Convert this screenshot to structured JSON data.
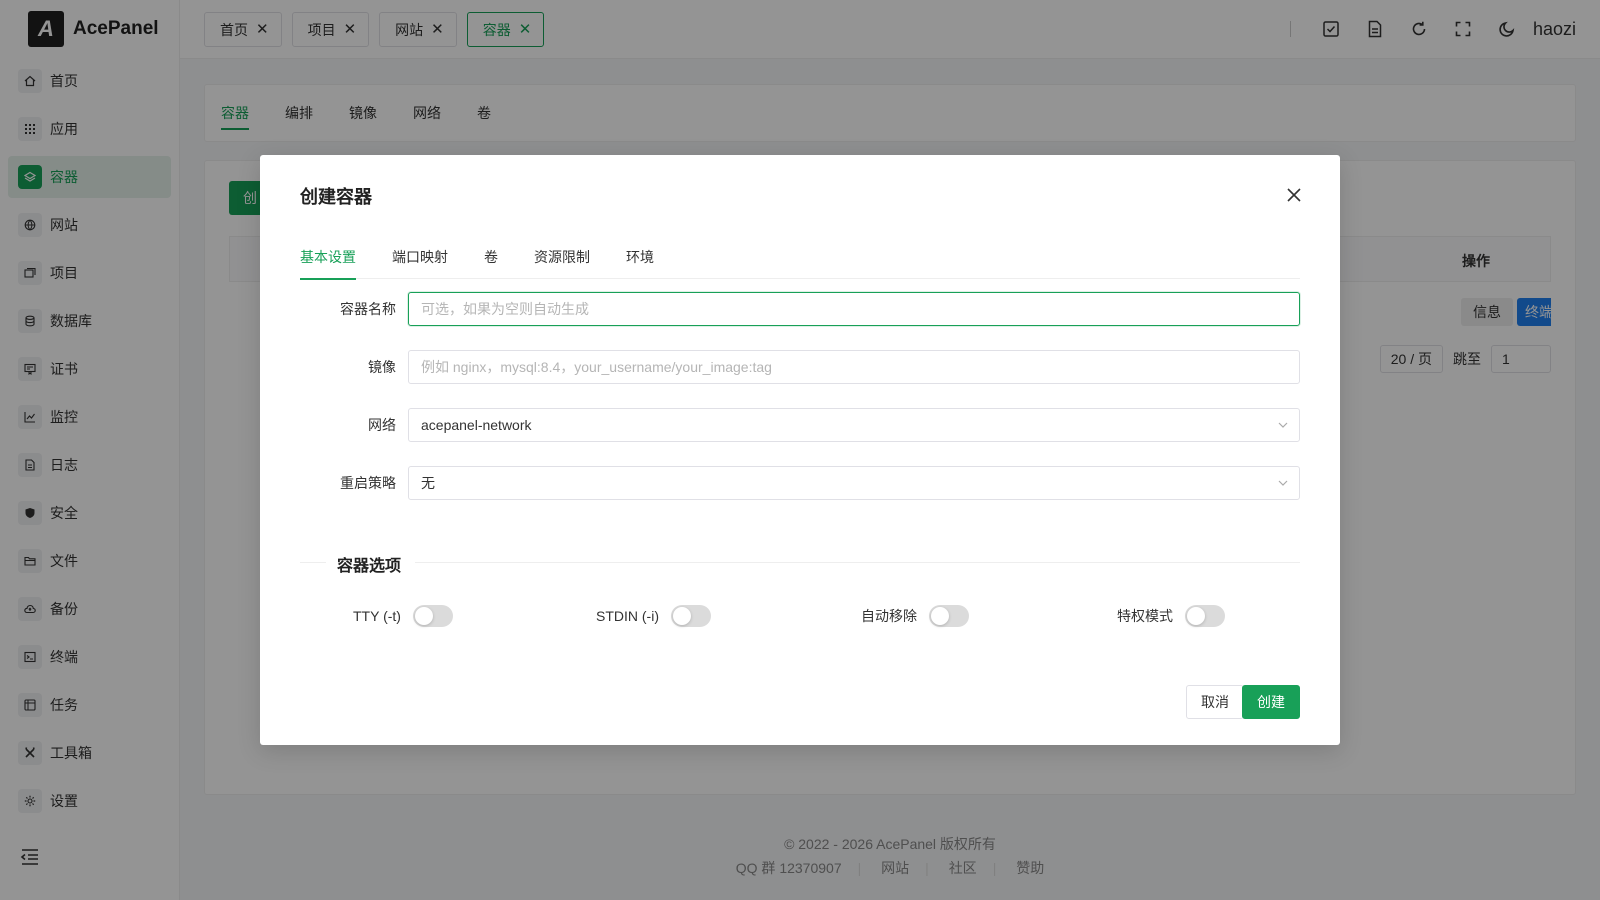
{
  "brand": {
    "logo": "A",
    "name": "AcePanel"
  },
  "sidebar": {
    "items": [
      {
        "label": "首页",
        "icon": "home-icon"
      },
      {
        "label": "应用",
        "icon": "grid-icon"
      },
      {
        "label": "容器",
        "icon": "layers-icon",
        "active": true
      },
      {
        "label": "网站",
        "icon": "globe-icon"
      },
      {
        "label": "项目",
        "icon": "folder-stack-icon"
      },
      {
        "label": "数据库",
        "icon": "database-icon"
      },
      {
        "label": "证书",
        "icon": "certificate-icon"
      },
      {
        "label": "监控",
        "icon": "chart-line-icon"
      },
      {
        "label": "日志",
        "icon": "document-icon"
      },
      {
        "label": "安全",
        "icon": "shield-icon"
      },
      {
        "label": "文件",
        "icon": "folder-icon"
      },
      {
        "label": "备份",
        "icon": "cloud-backup-icon"
      },
      {
        "label": "终端",
        "icon": "terminal-icon"
      },
      {
        "label": "任务",
        "icon": "task-icon"
      },
      {
        "label": "工具箱",
        "icon": "tools-icon"
      },
      {
        "label": "设置",
        "icon": "gear-icon"
      }
    ]
  },
  "header": {
    "tabs": [
      {
        "label": "首页"
      },
      {
        "label": "项目"
      },
      {
        "label": "网站"
      },
      {
        "label": "容器",
        "active": true
      }
    ],
    "username": "haozi"
  },
  "main": {
    "subtabs": [
      "容器",
      "编排",
      "镜像",
      "网络",
      "卷"
    ],
    "create_label": "创",
    "table": {
      "op_header": "操作",
      "info_btn": "信息",
      "term_btn": "终端"
    },
    "pager": {
      "page_size": "20 / 页",
      "jump_label": "跳至",
      "jump_value": "1"
    }
  },
  "footer": {
    "copyright": "© 2022 - 2026 AcePanel 版权所有",
    "qq": "QQ 群 12370907",
    "link_site": "网站",
    "link_community": "社区",
    "link_sponsor": "赞助"
  },
  "modal": {
    "title": "创建容器",
    "tabs": [
      "基本设置",
      "端口映射",
      "卷",
      "资源限制",
      "环境"
    ],
    "fields": {
      "name_label": "容器名称",
      "name_placeholder": "可选，如果为空则自动生成",
      "image_label": "镜像",
      "image_placeholder": "例如 nginx，mysql:8.4，your_username/your_image:tag",
      "network_label": "网络",
      "network_value": "acepanel-network",
      "restart_label": "重启策略",
      "restart_value": "无"
    },
    "options_title": "容器选项",
    "switches": {
      "tty": "TTY (-t)",
      "stdin": "STDIN (-i)",
      "auto_remove": "自动移除",
      "privileged": "特权模式"
    },
    "cancel": "取消",
    "create": "创建"
  },
  "colors": {
    "accent": "#18a058",
    "primary_blue": "#2080f0"
  }
}
